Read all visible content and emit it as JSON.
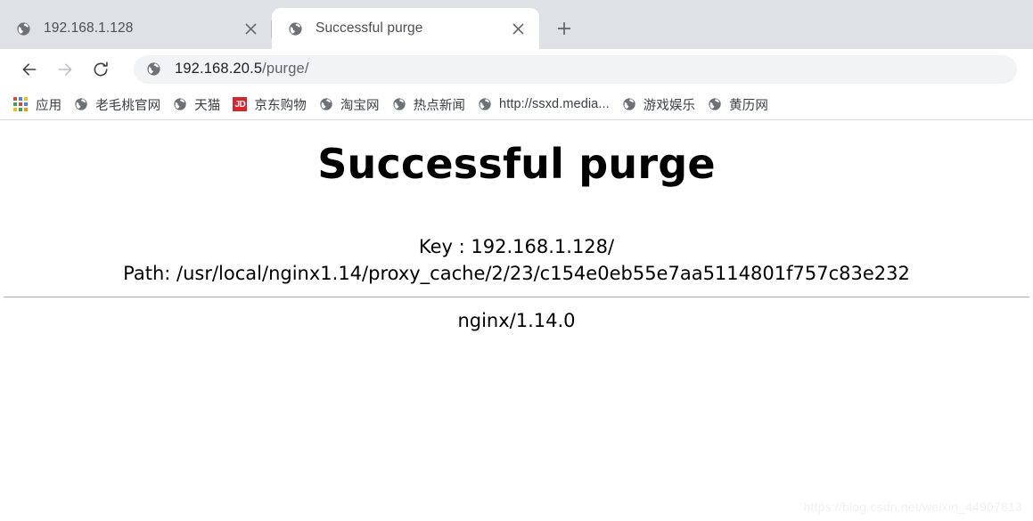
{
  "browser": {
    "tabs": [
      {
        "title": "192.168.1.128",
        "favicon": "globe-icon",
        "active": false,
        "close_label": "×"
      },
      {
        "title": "Successful purge",
        "favicon": "globe-icon",
        "active": true,
        "close_label": "×"
      }
    ],
    "new_tab_label": "+",
    "toolbar": {
      "back_label": "←",
      "forward_label": "→",
      "reload_label": "⟳",
      "omnibox": {
        "icon": "globe-icon",
        "url_host": "192.168.20.5",
        "url_path": "/purge/",
        "full_url": "192.168.20.5/purge/"
      }
    },
    "bookmarks": [
      {
        "label": "应用",
        "icon": "apps-grid-icon"
      },
      {
        "label": "老毛桃官网",
        "icon": "globe-icon"
      },
      {
        "label": "天猫",
        "icon": "globe-icon"
      },
      {
        "label": "京东购物",
        "icon": "jd-icon",
        "icon_text": "JD"
      },
      {
        "label": "淘宝网",
        "icon": "globe-icon"
      },
      {
        "label": "热点新闻",
        "icon": "globe-icon"
      },
      {
        "label": "http://ssxd.media...",
        "icon": "globe-icon"
      },
      {
        "label": "游戏娱乐",
        "icon": "globe-icon"
      },
      {
        "label": "黄历网",
        "icon": "globe-icon"
      }
    ]
  },
  "page": {
    "heading": "Successful purge",
    "key_line": "Key : 192.168.1.128/",
    "path_line": "Path: /usr/local/nginx1.14/proxy_cache/2/23/c154e0eb55e7aa5114801f757c83e232",
    "server_signature": "nginx/1.14.0",
    "watermark": "https://blog.csdn.net/weixin_44907813"
  },
  "colors": {
    "tabstrip_bg": "#dee1e6",
    "active_tab_bg": "#ffffff",
    "omnibox_bg": "#f1f3f4",
    "jd_red": "#d9242b",
    "text_primary": "#202124",
    "text_secondary": "#5f6368",
    "hr": "#a9a9a9",
    "watermark": "#f0f0f0"
  }
}
